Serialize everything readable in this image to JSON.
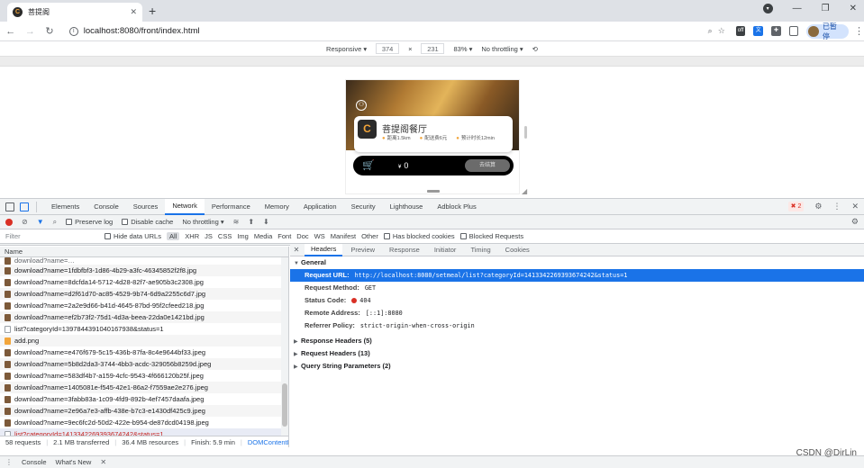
{
  "browser": {
    "tab_title": "菩提阁",
    "favicon_glyph": "C",
    "tab_close": "✕",
    "new_tab": "+",
    "url": "localhost:8080/front/index.html",
    "profile_label": "已暂停"
  },
  "device_toolbar": {
    "mode": "Responsive ▾",
    "width": "374",
    "times": "×",
    "height": "231",
    "zoom": "83% ▾",
    "throttle": "No throttling ▾"
  },
  "mobile_page": {
    "shop_name": "菩提阁餐厅",
    "shop_logo_glyph": "C",
    "metrics": [
      "距离1.5km",
      "配送费6元",
      "预计时长12min"
    ],
    "cart_currency": "¥",
    "cart_price": "0",
    "checkout_label": "去结算"
  },
  "devtools": {
    "tabs": [
      "Elements",
      "Console",
      "Sources",
      "Network",
      "Performance",
      "Memory",
      "Application",
      "Security",
      "Lighthouse",
      "Adblock Plus"
    ],
    "active_tab": "Network",
    "error_count": "2",
    "toolbar": {
      "preserve_log": "Preserve log",
      "disable_cache": "Disable cache",
      "throttling": "No throttling ▾"
    },
    "filter": {
      "placeholder": "Filter",
      "hide_data_urls": "Hide data URLs",
      "types": [
        "All",
        "XHR",
        "JS",
        "CSS",
        "Img",
        "Media",
        "Font",
        "Doc",
        "WS",
        "Manifest",
        "Other"
      ],
      "has_blocked_cookies": "Has blocked cookies",
      "blocked_requests": "Blocked Requests"
    },
    "requests": {
      "column_name": "Name",
      "items": [
        {
          "name": "download?name=1fdbfbf3-1d86-4b29-a3fc-46345852f2f8.jpg",
          "type": "img"
        },
        {
          "name": "download?name=8dcfda14-5712-4d28-82f7-ae905b3c2308.jpg",
          "type": "img"
        },
        {
          "name": "download?name=d2f61d70-ac85-4529-9b74-6d9a2255c6d7.jpg",
          "type": "img"
        },
        {
          "name": "download?name=2a2e9d66-b41d-4645-87bd-95f2cfeed218.jpg",
          "type": "img"
        },
        {
          "name": "download?name=ef2b73f2-75d1-4d3a-beea-22da0e1421bd.jpg",
          "type": "img"
        },
        {
          "name": "list?categoryId=1397844391040167938&status=1",
          "type": "doc"
        },
        {
          "name": "add.png",
          "type": "img"
        },
        {
          "name": "download?name=e476f679-5c15-436b-87fa-8c4e9644bf33.jpeg",
          "type": "img"
        },
        {
          "name": "download?name=5b8d2da3-3744-4bb3-acdc-329056b8259d.jpeg",
          "type": "img"
        },
        {
          "name": "download?name=583df4b7-a159-4cfc-9543-4f666120b25f.jpeg",
          "type": "img"
        },
        {
          "name": "download?name=1405081e-f545-42e1-86a2-f7559ae2e276.jpeg",
          "type": "img"
        },
        {
          "name": "download?name=3fabb83a-1c09-4fd9-892b-4ef7457daafa.jpeg",
          "type": "img"
        },
        {
          "name": "download?name=2e96a7e3-affb-438e-b7c3-e1430df425c9.jpeg",
          "type": "img"
        },
        {
          "name": "download?name=9ec6fc2d-50d2-422e-b954-de87dcd04198.jpeg",
          "type": "img"
        },
        {
          "name": "list?categoryId=1413342269393674242&status=1",
          "type": "doc",
          "selected": true
        }
      ]
    },
    "summary": {
      "requests": "58 requests",
      "transferred": "2.1 MB transferred",
      "resources": "36.4 MB resources",
      "finish": "Finish: 5.9 min",
      "dcl": "DOMContentLoad"
    },
    "detail": {
      "tabs": [
        "Headers",
        "Preview",
        "Response",
        "Initiator",
        "Timing",
        "Cookies"
      ],
      "active_tab": "Headers",
      "general_title": "General",
      "request_url_label": "Request URL:",
      "request_url": "http://localhost:8080/setmeal/list?categoryId=1413342269393674242&status=1",
      "method_label": "Request Method:",
      "method": "GET",
      "status_label": "Status Code:",
      "status": "404",
      "remote_label": "Remote Address:",
      "remote": "[::1]:8080",
      "referrer_label": "Referrer Policy:",
      "referrer": "strict-origin-when-cross-origin",
      "response_headers": "Response Headers (5)",
      "request_headers": "Request Headers (13)",
      "query_params": "Query String Parameters (2)"
    },
    "drawer_tabs": [
      "Console",
      "What's New"
    ]
  },
  "watermark": "CSDN @DirLin"
}
